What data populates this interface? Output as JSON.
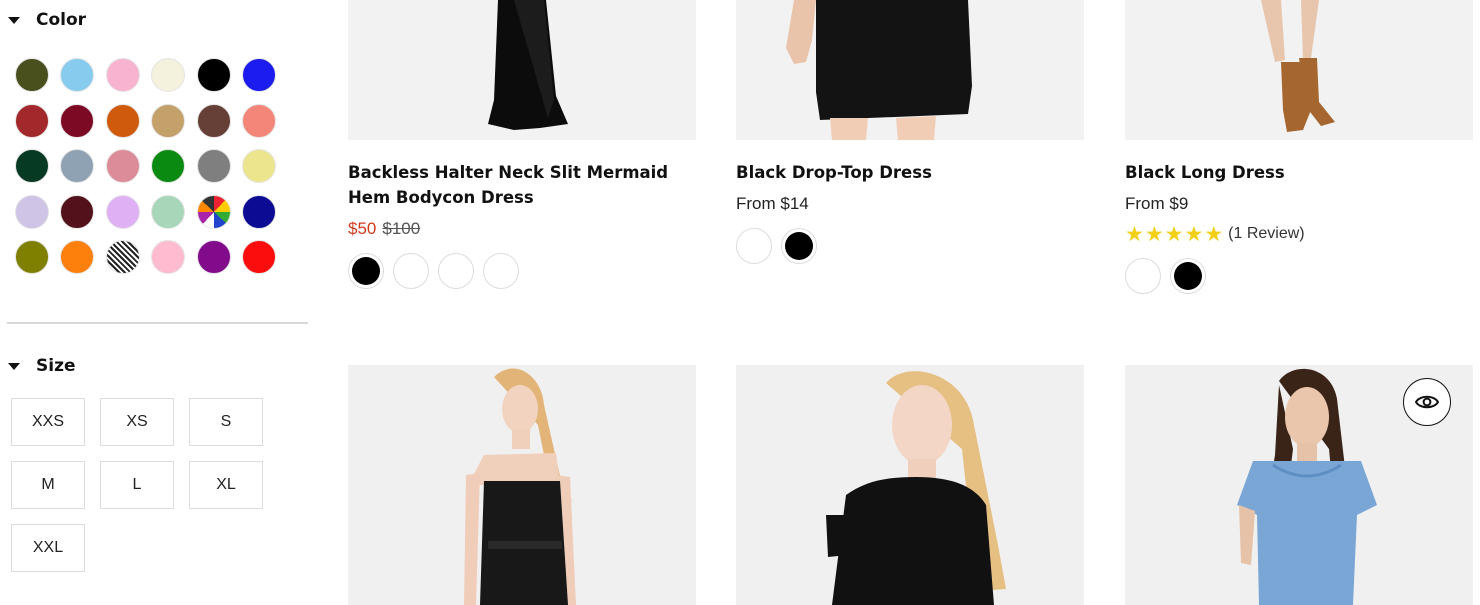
{
  "filters": {
    "color": {
      "title": "Color",
      "swatches": [
        {
          "name": "olive-dark",
          "hex": "#4a4f1e"
        },
        {
          "name": "sky-blue",
          "hex": "#87ccef"
        },
        {
          "name": "light-pink",
          "hex": "#f7b3cf"
        },
        {
          "name": "beige",
          "hex": "#f4f2dd"
        },
        {
          "name": "black",
          "hex": "#000000"
        },
        {
          "name": "blue",
          "hex": "#1c1cf0"
        },
        {
          "name": "red-brown",
          "hex": "#a3282b"
        },
        {
          "name": "maroon",
          "hex": "#7d0a24"
        },
        {
          "name": "burnt-orange",
          "hex": "#cf5a0c"
        },
        {
          "name": "tan",
          "hex": "#c4a06a"
        },
        {
          "name": "brown",
          "hex": "#664036"
        },
        {
          "name": "salmon",
          "hex": "#f38678"
        },
        {
          "name": "dark-green",
          "hex": "#073a23"
        },
        {
          "name": "slate-blue",
          "hex": "#8ea2b4"
        },
        {
          "name": "rose",
          "hex": "#dc8c98"
        },
        {
          "name": "green",
          "hex": "#0b8a12"
        },
        {
          "name": "gray",
          "hex": "#7f7f7f"
        },
        {
          "name": "khaki",
          "hex": "#ede58e"
        },
        {
          "name": "lavender",
          "hex": "#cfc4e6"
        },
        {
          "name": "dark-maroon",
          "hex": "#53111b"
        },
        {
          "name": "light-violet",
          "hex": "#dfb0f3"
        },
        {
          "name": "mint",
          "hex": "#a8d6b8"
        },
        {
          "name": "geometric-multicolor",
          "hex": "pattern-geo"
        },
        {
          "name": "navy",
          "hex": "#0b0b94"
        },
        {
          "name": "olive",
          "hex": "#808000"
        },
        {
          "name": "orange",
          "hex": "#fe800c"
        },
        {
          "name": "black-white-pattern",
          "hex": "pattern-bw"
        },
        {
          "name": "pink",
          "hex": "#ffbbd0"
        },
        {
          "name": "purple",
          "hex": "#820b8c"
        },
        {
          "name": "red",
          "hex": "#fc0d0d"
        }
      ]
    },
    "size": {
      "title": "Size",
      "options": [
        "XXS",
        "XS",
        "S",
        "M",
        "L",
        "XL",
        "XXL"
      ]
    }
  },
  "products": [
    {
      "name": "Backless Halter Neck Slit Mermaid Hem Bodycon Dress",
      "sale_price": "$50",
      "compare_price": "$100",
      "variants": [
        "#000000",
        "#ffffff",
        "#ffffff",
        "#ffffff"
      ]
    },
    {
      "name": "Black Drop-Top Dress",
      "price": "From $14",
      "variants": [
        "#ffffff",
        "#000000"
      ]
    },
    {
      "name": "Black Long Dress",
      "price": "From $9",
      "rating": 5,
      "review_text": "(1 Review)",
      "variants": [
        "#ffffff",
        "#000000"
      ]
    },
    {
      "image": "model-black-strappy-dress"
    },
    {
      "image": "model-black-short-sleeve-top"
    },
    {
      "image": "model-denim-dress",
      "quick_view_icon": "eye-icon"
    }
  ],
  "colors": {
    "sale_red": "#d23a1b",
    "star_yellow": "#f2d016"
  }
}
